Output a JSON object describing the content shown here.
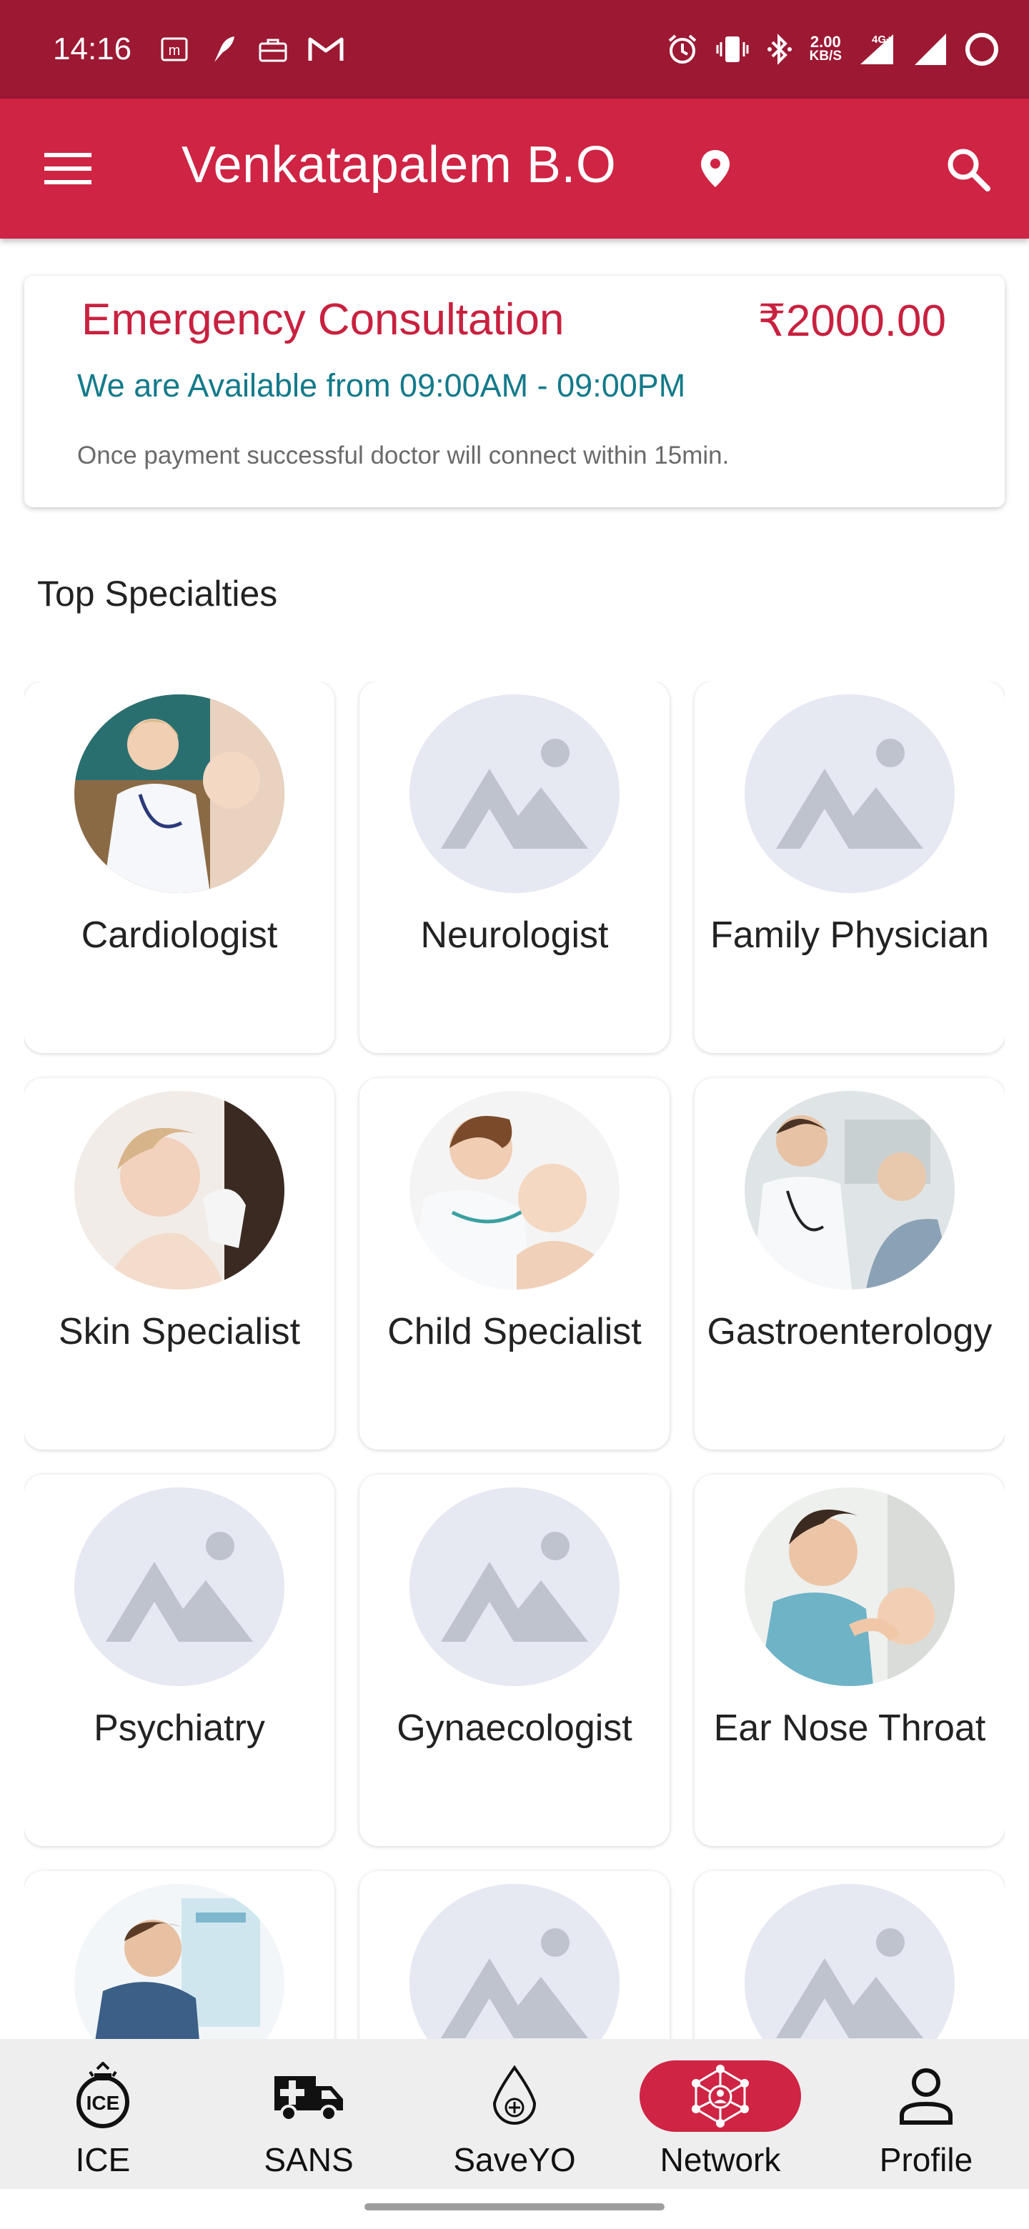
{
  "status_bar": {
    "time": "14:16",
    "net_speed_value": "2.00",
    "net_speed_unit": "KB/S",
    "network_type": "4G+"
  },
  "app_bar": {
    "title": "Venkatapalem B.O"
  },
  "consultation": {
    "title": "Emergency Consultation",
    "price": "₹2000.00",
    "hours": "We are Available from 09:00AM - 09:00PM",
    "note": "Once payment successful doctor will connect within 15min."
  },
  "section": {
    "title": "Top Specialties"
  },
  "specialties": [
    {
      "label": "Cardiologist",
      "image": "photo-doctor-stethoscope"
    },
    {
      "label": "Neurologist",
      "image": "image-placeholder-icon"
    },
    {
      "label": "Family Physician",
      "image": "image-placeholder-icon"
    },
    {
      "label": "Skin Specialist",
      "image": "photo-skin-exam"
    },
    {
      "label": "Child Specialist",
      "image": "photo-child-doctor"
    },
    {
      "label": "Gastroenterology",
      "image": "photo-gastro-consult"
    },
    {
      "label": "Psychiatry",
      "image": "image-placeholder-icon"
    },
    {
      "label": "Gynaecologist",
      "image": "image-placeholder-icon"
    },
    {
      "label": "Ear Nose Throat",
      "image": "photo-ent-exam"
    },
    {
      "label": "",
      "image": "photo-man-clinic"
    },
    {
      "label": "",
      "image": "image-placeholder-icon"
    },
    {
      "label": "",
      "image": "image-placeholder-icon"
    }
  ],
  "bottom_nav": [
    {
      "label": "ICE",
      "icon": "ice-siren-icon"
    },
    {
      "label": "SANS",
      "icon": "ambulance-icon"
    },
    {
      "label": "SaveYO",
      "icon": "blood-drop-icon"
    },
    {
      "label": "Network",
      "icon": "network-icon",
      "active": true
    },
    {
      "label": "Profile",
      "icon": "person-icon"
    }
  ],
  "colors": {
    "status_bar": "#9c1833",
    "app_bar": "#cf2444",
    "accent_red": "#c8213f",
    "accent_teal": "#137a8a"
  }
}
